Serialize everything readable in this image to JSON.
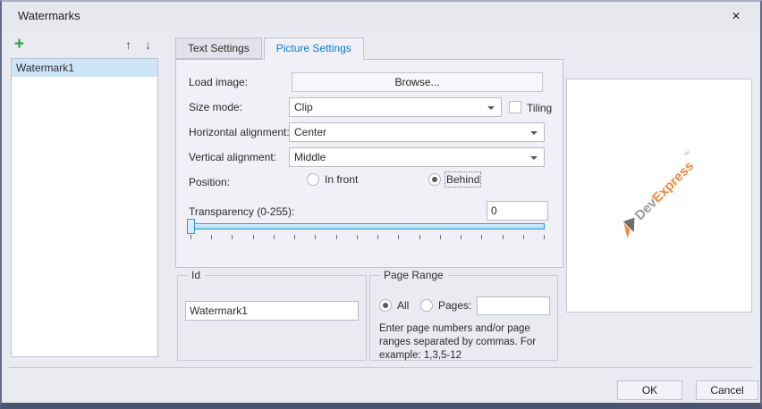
{
  "window": {
    "title": "Watermarks"
  },
  "icons": {
    "close": "✕",
    "add": "+",
    "move_up": "↑",
    "move_down": "↓",
    "dropdown": "▼"
  },
  "colors": {
    "accent_blue": "#0b7bd3",
    "slider_blue": "#2a9ad6",
    "selection_blue": "#cde6f7",
    "add_green": "#2e9e41",
    "logo_orange": "#f08a3c",
    "logo_gray": "#9a9a9a",
    "window_border": "#4d5470"
  },
  "left_panel": {
    "items": [
      {
        "label": "Watermark1",
        "selected": true
      }
    ]
  },
  "tabs": [
    {
      "label": "Text Settings",
      "active": false
    },
    {
      "label": "Picture Settings",
      "active": true
    }
  ],
  "picture_settings": {
    "load_image_label": "Load image:",
    "browse_button": "Browse...",
    "size_mode_label": "Size mode:",
    "size_mode_value": "Clip",
    "tiling_label": "Tiling",
    "tiling_checked": false,
    "horizontal_alignment_label": "Horizontal alignment:",
    "horizontal_alignment_value": "Center",
    "vertical_alignment_label": "Vertical alignment:",
    "vertical_alignment_value": "Middle",
    "position_label": "Position:",
    "position_options": [
      {
        "label": "In front",
        "selected": false
      },
      {
        "label": "Behind",
        "selected": true
      }
    ],
    "transparency_label": "Transparency (0-255):",
    "transparency_value": "0",
    "slider": {
      "min": 0,
      "max": 255,
      "value": 0,
      "ticks": 18
    }
  },
  "id_group": {
    "title": "Id",
    "value": "Watermark1"
  },
  "page_range_group": {
    "title": "Page Range",
    "options": [
      {
        "label": "All",
        "selected": true
      },
      {
        "label": "Pages:",
        "selected": false
      }
    ],
    "pages_value": "",
    "help_text": "Enter page numbers and/or page ranges separated by commas. For example: 1,3,5-12"
  },
  "preview": {
    "logo_dev": "Dev",
    "logo_express": "Express",
    "trademark": "™"
  },
  "footer": {
    "ok_label": "OK",
    "cancel_label": "Cancel"
  }
}
